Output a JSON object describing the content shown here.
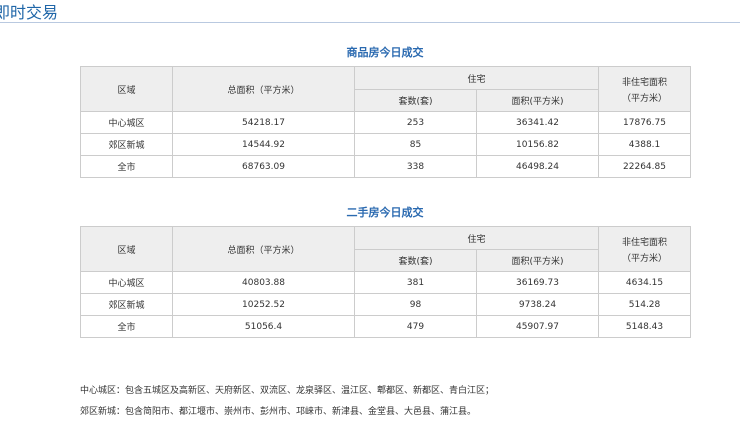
{
  "page": {
    "title": "即时交易",
    "columns": {
      "region": "区域",
      "total_area": "总面积（平方米）",
      "residential": "住宅",
      "units": "套数(套)",
      "area": "面积(平方米)",
      "non_residential_1": "非住宅面积",
      "non_residential_2": "（平方米）"
    }
  },
  "new_homes": {
    "title": "商品房今日成交",
    "rows": [
      {
        "region": "中心城区",
        "total": "54218.17",
        "units": "253",
        "area": "36341.42",
        "non_res": "17876.75"
      },
      {
        "region": "郊区新城",
        "total": "14544.92",
        "units": "85",
        "area": "10156.82",
        "non_res": "4388.1"
      },
      {
        "region": "全市",
        "total": "68763.09",
        "units": "338",
        "area": "46498.24",
        "non_res": "22264.85"
      }
    ]
  },
  "second_hand": {
    "title": "二手房今日成交",
    "rows": [
      {
        "region": "中心城区",
        "total": "40803.88",
        "units": "381",
        "area": "36169.73",
        "non_res": "4634.15"
      },
      {
        "region": "郊区新城",
        "total": "10252.52",
        "units": "98",
        "area": "9738.24",
        "non_res": "514.28"
      },
      {
        "region": "全市",
        "total": "51056.4",
        "units": "479",
        "area": "45907.97",
        "non_res": "5148.43"
      }
    ]
  },
  "notes": {
    "central": "中心城区：包含五城区及高新区、天府新区、双流区、龙泉驿区、温江区、郫都区、新都区、青白江区；",
    "suburban": "郊区新城：包含简阳市、都江堰市、崇州市、彭州市、邛崃市、新津县、金堂县、大邑县、蒲江县。"
  }
}
